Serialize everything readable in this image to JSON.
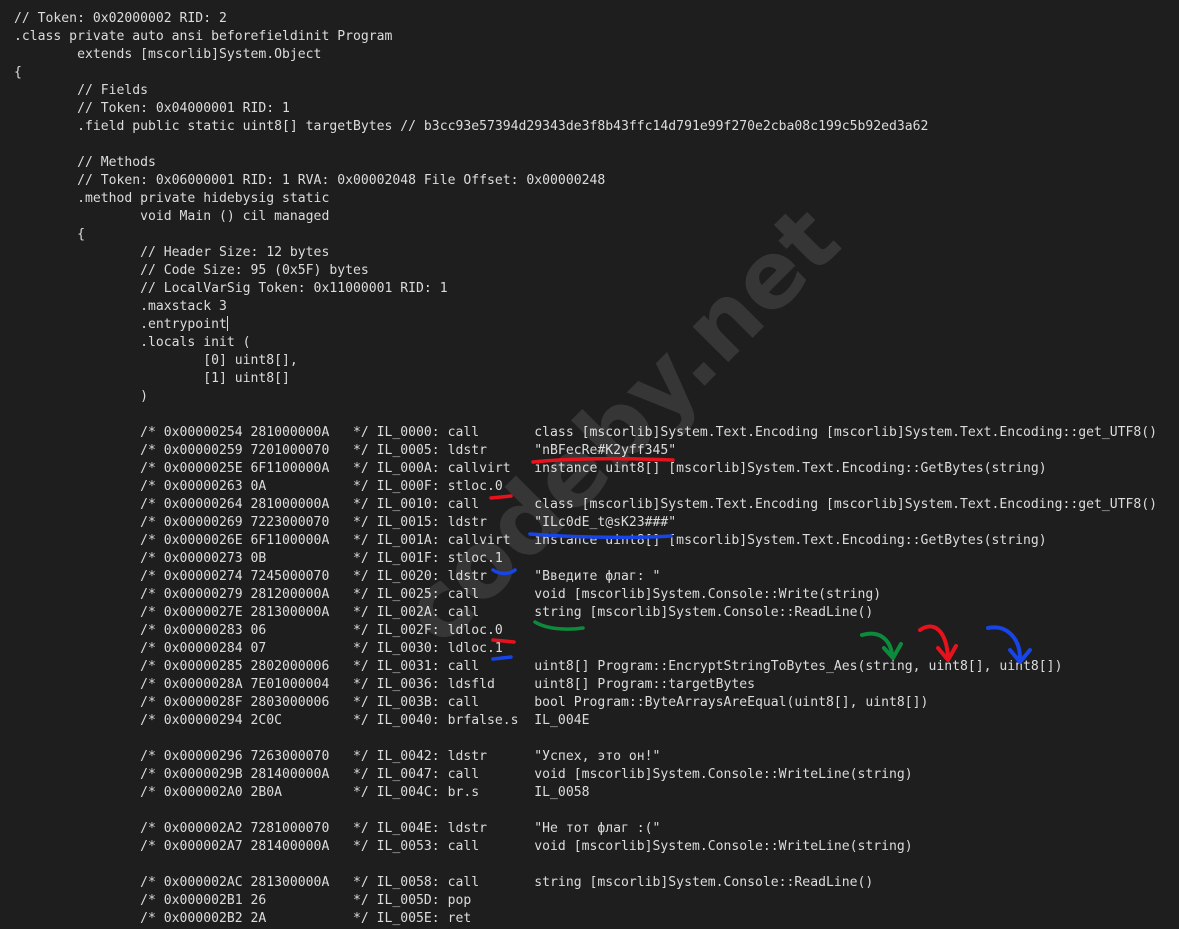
{
  "watermark": "codeby.net",
  "colors": {
    "background": "#1e1e1e",
    "text": "#dcdcdc",
    "annotation_red": "#e8121c",
    "annotation_blue": "#1745e8",
    "annotation_green": "#0d8a3c"
  },
  "code": {
    "cursor_line": 17,
    "lines": [
      "// Token: 0x02000002 RID: 2",
      ".class private auto ansi beforefieldinit Program",
      "        extends [mscorlib]System.Object",
      "{",
      "        // Fields",
      "        // Token: 0x04000001 RID: 1",
      "        .field public static uint8[] targetBytes // b3cc93e57394d29343de3f8b43ffc14d791e99f270e2cba08c199c5b92ed3a62",
      "",
      "        // Methods",
      "        // Token: 0x06000001 RID: 1 RVA: 0x00002048 File Offset: 0x00000248",
      "        .method private hidebysig static",
      "                void Main () cil managed",
      "        {",
      "                // Header Size: 12 bytes",
      "                // Code Size: 95 (0x5F) bytes",
      "                // LocalVarSig Token: 0x11000001 RID: 1",
      "                .maxstack 3",
      "                .entrypoint",
      "                .locals init (",
      "                        [0] uint8[],",
      "                        [1] uint8[]",
      "                )",
      "",
      "                /* 0x00000254 281000000A   */ IL_0000: call       class [mscorlib]System.Text.Encoding [mscorlib]System.Text.Encoding::get_UTF8()",
      "                /* 0x00000259 7201000070   */ IL_0005: ldstr      \"nBFecRe#K2yff345\"",
      "                /* 0x0000025E 6F1100000A   */ IL_000A: callvirt   instance uint8[] [mscorlib]System.Text.Encoding::GetBytes(string)",
      "                /* 0x00000263 0A           */ IL_000F: stloc.0",
      "                /* 0x00000264 281000000A   */ IL_0010: call       class [mscorlib]System.Text.Encoding [mscorlib]System.Text.Encoding::get_UTF8()",
      "                /* 0x00000269 7223000070   */ IL_0015: ldstr      \"ILc0dE_t@sK23###\"",
      "                /* 0x0000026E 6F1100000A   */ IL_001A: callvirt   instance uint8[] [mscorlib]System.Text.Encoding::GetBytes(string)",
      "                /* 0x00000273 0B           */ IL_001F: stloc.1",
      "                /* 0x00000274 7245000070   */ IL_0020: ldstr      \"Введите флаг: \"",
      "                /* 0x00000279 281200000A   */ IL_0025: call       void [mscorlib]System.Console::Write(string)",
      "                /* 0x0000027E 281300000A   */ IL_002A: call       string [mscorlib]System.Console::ReadLine()",
      "                /* 0x00000283 06           */ IL_002F: ldloc.0",
      "                /* 0x00000284 07           */ IL_0030: ldloc.1",
      "                /* 0x00000285 2802000006   */ IL_0031: call       uint8[] Program::EncryptStringToBytes_Aes(string, uint8[], uint8[])",
      "                /* 0x0000028A 7E01000004   */ IL_0036: ldsfld     uint8[] Program::targetBytes",
      "                /* 0x0000028F 2803000006   */ IL_003B: call       bool Program::ByteArraysAreEqual(uint8[], uint8[])",
      "                /* 0x00000294 2C0C         */ IL_0040: brfalse.s  IL_004E",
      "",
      "                /* 0x00000296 7263000070   */ IL_0042: ldstr      \"Успех, это он!\"",
      "                /* 0x0000029B 281400000A   */ IL_0047: call       void [mscorlib]System.Console::WriteLine(string)",
      "                /* 0x000002A0 2B0A         */ IL_004C: br.s       IL_0058",
      "",
      "                /* 0x000002A2 7281000070   */ IL_004E: ldstr      \"Не тот флаг :(\"",
      "                /* 0x000002A7 281400000A   */ IL_0053: call       void [mscorlib]System.Console::WriteLine(string)",
      "",
      "                /* 0x000002AC 281300000A   */ IL_0058: call       string [mscorlib]System.Console::ReadLine()",
      "                /* 0x000002B1 26           */ IL_005D: pop",
      "                /* 0x000002B2 2A           */ IL_005E: ret"
    ]
  }
}
